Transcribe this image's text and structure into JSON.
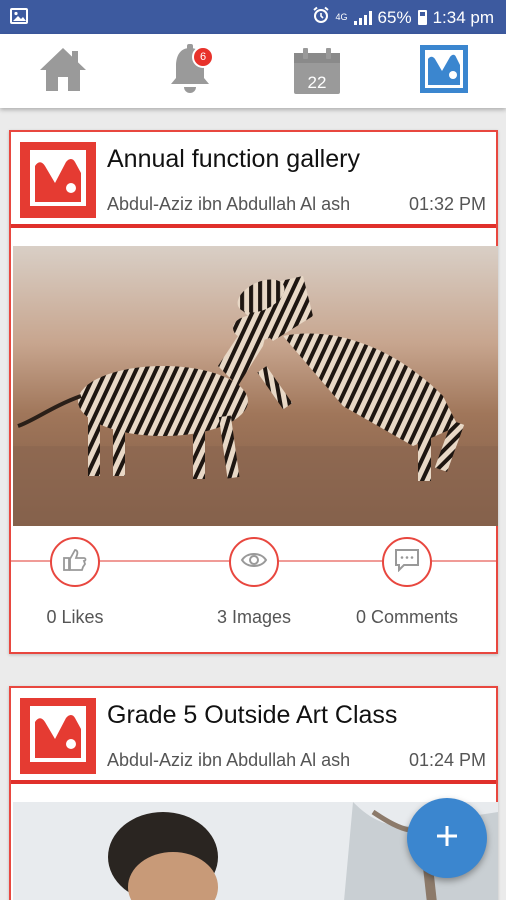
{
  "status_bar": {
    "network": "4G",
    "battery": "65%",
    "time": "1:34 pm",
    "icons": [
      "gallery-notification-icon",
      "alarm-icon",
      "signal-icon",
      "battery-icon"
    ]
  },
  "tabs": [
    {
      "name": "home",
      "icon": "home-icon"
    },
    {
      "name": "notifications",
      "icon": "bell-icon",
      "badge": "6"
    },
    {
      "name": "calendar",
      "icon": "calendar-icon",
      "day": "22"
    },
    {
      "name": "gallery",
      "icon": "gallery-icon",
      "active": true
    }
  ],
  "colors": {
    "status_bar": "#3d5a9f",
    "accent_red": "#e53b32",
    "fab_blue": "#3b86cf",
    "active_tab_blue": "#3b86cf",
    "inactive_tab_gray": "#9a9a9a"
  },
  "posts": [
    {
      "title": "Annual function gallery",
      "author": "Abdul-Aziz ibn Abdullah Al ash",
      "time": "01:32 PM",
      "image": "photo of two zebras fighting",
      "likes_label": "0 Likes",
      "images_label": "3 Images",
      "comments_label": "0 Comments"
    },
    {
      "title": "Grade 5 Outside Art Class",
      "author": "Abdul-Aziz ibn Abdullah Al ash",
      "time": "01:24 PM",
      "image": "photo of a child outdoors"
    }
  ],
  "fab": {
    "label": "+",
    "icon": "plus-icon"
  }
}
